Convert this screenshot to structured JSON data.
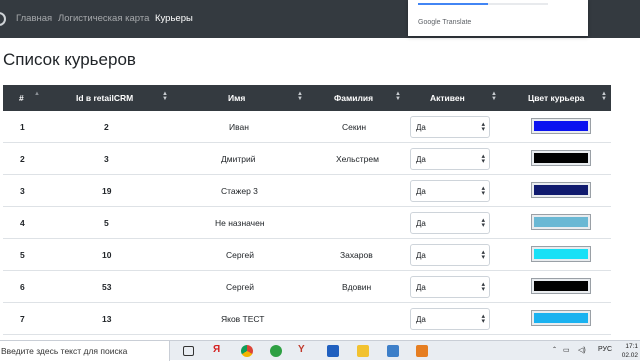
{
  "navbar": {
    "links": [
      {
        "label": "Главная",
        "active": false
      },
      {
        "label": "Логистическая карта",
        "active": false
      },
      {
        "label": "Курьеры",
        "active": true
      }
    ]
  },
  "google_translate": {
    "google": "Google",
    "translate": "Translate"
  },
  "page": {
    "title": "Список курьеров"
  },
  "table": {
    "columns": [
      "#",
      "Id в retailCRM",
      "Имя",
      "Фамилия",
      "Активен",
      "Цвет курьера"
    ],
    "rows": [
      {
        "num": "1",
        "crm_id": "2",
        "name": "Иван",
        "surname": "Секин",
        "active": "Да",
        "color": "#0a12f0"
      },
      {
        "num": "2",
        "crm_id": "3",
        "name": "Дмитрий",
        "surname": "Хельстрем",
        "active": "Да",
        "color": "#000000"
      },
      {
        "num": "3",
        "crm_id": "19",
        "name": "Стажер 3",
        "surname": "",
        "active": "Да",
        "color": "#101a6e"
      },
      {
        "num": "4",
        "crm_id": "5",
        "name": "Не назначен",
        "surname": "",
        "active": "Да",
        "color": "#6ab8d4"
      },
      {
        "num": "5",
        "crm_id": "10",
        "name": "Сергей",
        "surname": "Захаров",
        "active": "Да",
        "color": "#18e0f6"
      },
      {
        "num": "6",
        "crm_id": "53",
        "name": "Сергей",
        "surname": "Вдовин",
        "active": "Да",
        "color": "#000000"
      },
      {
        "num": "7",
        "crm_id": "13",
        "name": "Яков ТЕСТ",
        "surname": "",
        "active": "Да",
        "color": "#1ab2f0"
      }
    ]
  },
  "taskbar": {
    "search_placeholder": "Введите здесь текст для поиска",
    "language": "РУС",
    "time": "17:1",
    "date": "02.02"
  }
}
